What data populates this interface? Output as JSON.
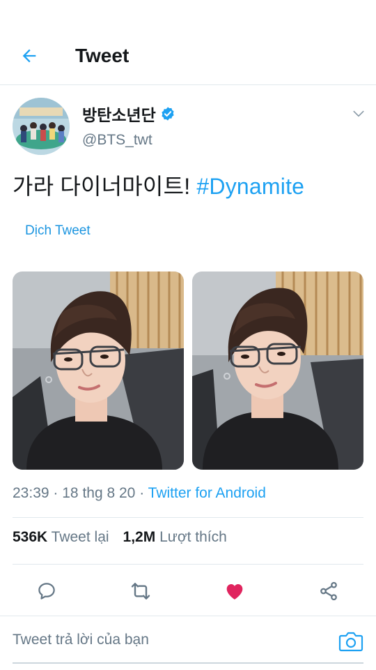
{
  "header": {
    "title": "Tweet",
    "back_icon": "arrow-left-icon"
  },
  "author": {
    "name": "방탄소년단",
    "handle": "@BTS_twt",
    "verified": true
  },
  "tweet": {
    "text": "가라 다이너마이트!",
    "hashtag": "#Dynamite",
    "translate_label": "Dịch Tweet"
  },
  "meta": {
    "time": "23:39",
    "date": "18 thg 8 20",
    "separator": "·",
    "source": "Twitter for Android"
  },
  "stats": {
    "retweets_count": "536K",
    "retweets_label": "Tweet lại",
    "likes_count": "1,2M",
    "likes_label": "Lượt thích"
  },
  "actions": [
    "reply-icon",
    "retweet-icon",
    "like-icon",
    "share-icon"
  ],
  "reply": {
    "placeholder": "Tweet trả lời của bạn"
  },
  "colors": {
    "accent": "#1da1f2",
    "like": "#e0245e",
    "muted": "#657786",
    "border": "#e1e8ed"
  }
}
